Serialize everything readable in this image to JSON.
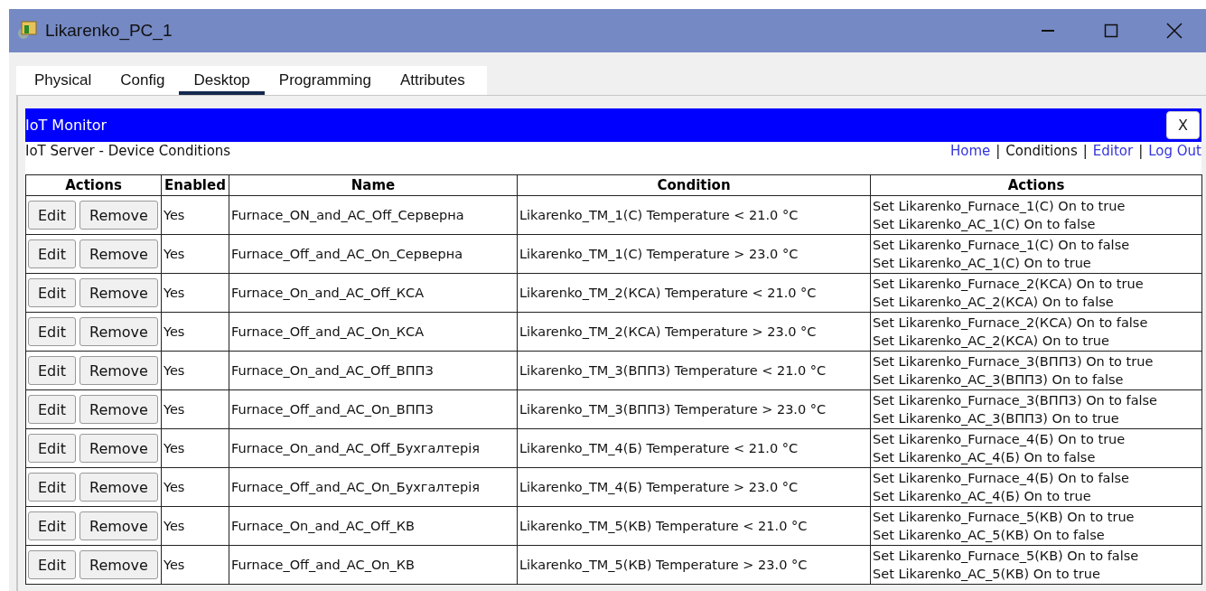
{
  "window": {
    "title": "Likarenko_PC_1"
  },
  "tabs": [
    {
      "label": "Physical",
      "selected": false
    },
    {
      "label": "Config",
      "selected": false
    },
    {
      "label": "Desktop",
      "selected": true
    },
    {
      "label": "Programming",
      "selected": false
    },
    {
      "label": "Attributes",
      "selected": false
    }
  ],
  "app": {
    "title": "IoT Monitor",
    "close_label": "X",
    "subtitle": "IoT Server - Device Conditions",
    "nav": [
      {
        "label": "Home",
        "kind": "link"
      },
      {
        "label": "|",
        "kind": "separator"
      },
      {
        "label": "Conditions",
        "kind": "current"
      },
      {
        "label": "|",
        "kind": "separator"
      },
      {
        "label": "Editor",
        "kind": "link"
      },
      {
        "label": "|",
        "kind": "separator"
      },
      {
        "label": "Log Out",
        "kind": "link"
      }
    ]
  },
  "table": {
    "columns": [
      "Actions",
      "Enabled",
      "Name",
      "Condition",
      "Actions"
    ],
    "rows": [
      {
        "buttons": [
          "Edit",
          "Remove"
        ],
        "enabled": "Yes",
        "name": "Furnace_ON_and_AC_Off_Серверна",
        "condition": "Likarenko_TM_1(С) Temperature < 21.0 °C",
        "actions": [
          "Set Likarenko_Furnace_1(С) On to true",
          "Set Likarenko_AC_1(С) On to false"
        ]
      },
      {
        "buttons": [
          "Edit",
          "Remove"
        ],
        "enabled": "Yes",
        "name": "Furnace_Off_and_AC_On_Серверна",
        "condition": "Likarenko_TM_1(С) Temperature > 23.0 °C",
        "actions": [
          "Set Likarenko_Furnace_1(С) On to false",
          "Set Likarenko_AC_1(С) On to true"
        ]
      },
      {
        "buttons": [
          "Edit",
          "Remove"
        ],
        "enabled": "Yes",
        "name": "Furnace_On_and_AC_Off_КСА",
        "condition": "Likarenko_TM_2(КСА) Temperature < 21.0 °C",
        "actions": [
          "Set Likarenko_Furnace_2(КСА) On to true",
          "Set Likarenko_AC_2(КСА) On to false"
        ]
      },
      {
        "buttons": [
          "Edit",
          "Remove"
        ],
        "enabled": "Yes",
        "name": "Furnace_Off_and_AC_On_КСА",
        "condition": "Likarenko_TM_2(КСА) Temperature > 23.0 °C",
        "actions": [
          "Set Likarenko_Furnace_2(КСА) On to false",
          "Set Likarenko_AC_2(КСА) On to true"
        ]
      },
      {
        "buttons": [
          "Edit",
          "Remove"
        ],
        "enabled": "Yes",
        "name": "Furnace_On_and_AC_Off_ВППЗ",
        "condition": "Likarenko_TM_3(ВППЗ) Temperature < 21.0 °C",
        "actions": [
          "Set Likarenko_Furnace_3(ВППЗ) On to true",
          "Set Likarenko_AC_3(ВППЗ) On to false"
        ]
      },
      {
        "buttons": [
          "Edit",
          "Remove"
        ],
        "enabled": "Yes",
        "name": "Furnace_Off_and_AC_On_ВППЗ",
        "condition": "Likarenko_TM_3(ВППЗ) Temperature > 23.0 °C",
        "actions": [
          "Set Likarenko_Furnace_3(ВППЗ) On to false",
          "Set Likarenko_AC_3(ВППЗ) On to true"
        ]
      },
      {
        "buttons": [
          "Edit",
          "Remove"
        ],
        "enabled": "Yes",
        "name": "Furnace_On_and_AC_Off_Бухгалтерія",
        "condition": "Likarenko_TM_4(Б) Temperature < 21.0 °C",
        "actions": [
          "Set Likarenko_Furnace_4(Б) On to true",
          "Set Likarenko_AC_4(Б) On to false"
        ]
      },
      {
        "buttons": [
          "Edit",
          "Remove"
        ],
        "enabled": "Yes",
        "name": "Furnace_Off_and_AC_On_Бухгалтерія",
        "condition": "Likarenko_TM_4(Б) Temperature > 23.0 °C",
        "actions": [
          "Set Likarenko_Furnace_4(Б) On to false",
          "Set Likarenko_AC_4(Б) On to true"
        ]
      },
      {
        "buttons": [
          "Edit",
          "Remove"
        ],
        "enabled": "Yes",
        "name": "Furnace_On_and_AC_Off_КВ",
        "condition": "Likarenko_TM_5(КВ) Temperature < 21.0 °C",
        "actions": [
          "Set Likarenko_Furnace_5(КВ) On to true",
          "Set Likarenko_AC_5(КВ) On to false"
        ]
      },
      {
        "buttons": [
          "Edit",
          "Remove"
        ],
        "enabled": "Yes",
        "name": "Furnace_Off_and_AC_On_КВ",
        "condition": "Likarenko_TM_5(КВ) Temperature > 23.0 °C",
        "actions": [
          "Set Likarenko_Furnace_5(КВ) On to false",
          "Set Likarenko_AC_5(КВ) On to true"
        ]
      }
    ]
  }
}
